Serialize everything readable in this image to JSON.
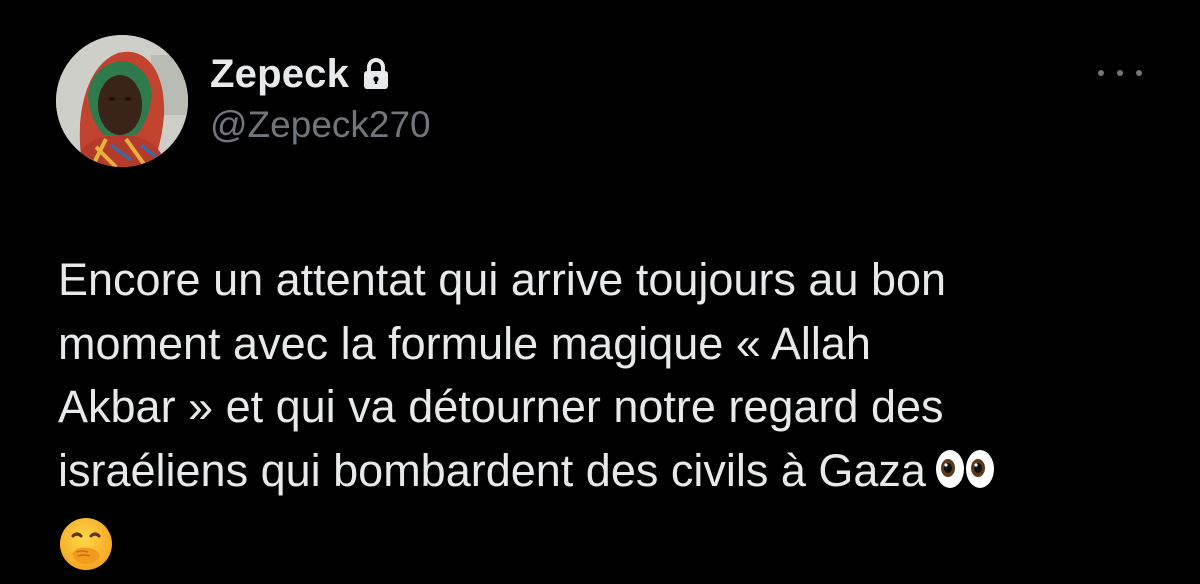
{
  "tweet": {
    "author": {
      "display_name": "Zepeck",
      "handle": "@Zepeck270",
      "protected_icon": "lock-icon",
      "avatar_icon": "avatar-photo"
    },
    "more_icon": "more-horizontal-icon",
    "text": "Encore un attentat qui arrive toujours au bon\nmoment avec la formule magique « Allah\nAkbar » et qui va détourner notre regard des\nisraéliens qui bombardent des civils à Gaza",
    "emojis": [
      "eyes-emoji",
      "face-with-hand-over-mouth-emoji"
    ]
  },
  "colors": {
    "background": "#000000",
    "primary_text": "#e7e9ea",
    "secondary_text": "#71767b"
  }
}
